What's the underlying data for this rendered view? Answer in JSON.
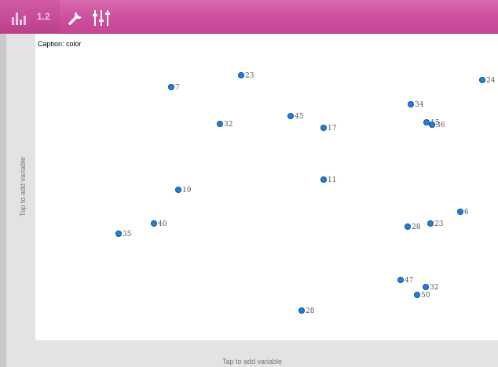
{
  "toolbar": {
    "tab_number": "1.2",
    "icons": [
      "bar-chart-icon",
      "wrench-icon",
      "sliders-icon"
    ],
    "colors": {
      "bar": "#cd4f9e",
      "icon": "#ffffff"
    }
  },
  "axis_prompts": {
    "y": "Tap to add variable",
    "x": "Tap to add variable"
  },
  "caption": "Caption: color",
  "point_color": "#1e7fe0",
  "chart_data": {
    "type": "scatter",
    "points": [
      {
        "label": "7"
      },
      {
        "label": "23"
      },
      {
        "label": "24"
      },
      {
        "label": "34"
      },
      {
        "label": "32"
      },
      {
        "label": "45"
      },
      {
        "label": "17"
      },
      {
        "label": "15"
      },
      {
        "label": "36"
      },
      {
        "label": "11"
      },
      {
        "label": "19"
      },
      {
        "label": "6"
      },
      {
        "label": "40"
      },
      {
        "label": "28"
      },
      {
        "label": "23"
      },
      {
        "label": "35"
      },
      {
        "label": "47"
      },
      {
        "label": "32"
      },
      {
        "label": "50"
      },
      {
        "label": "28"
      }
    ]
  }
}
